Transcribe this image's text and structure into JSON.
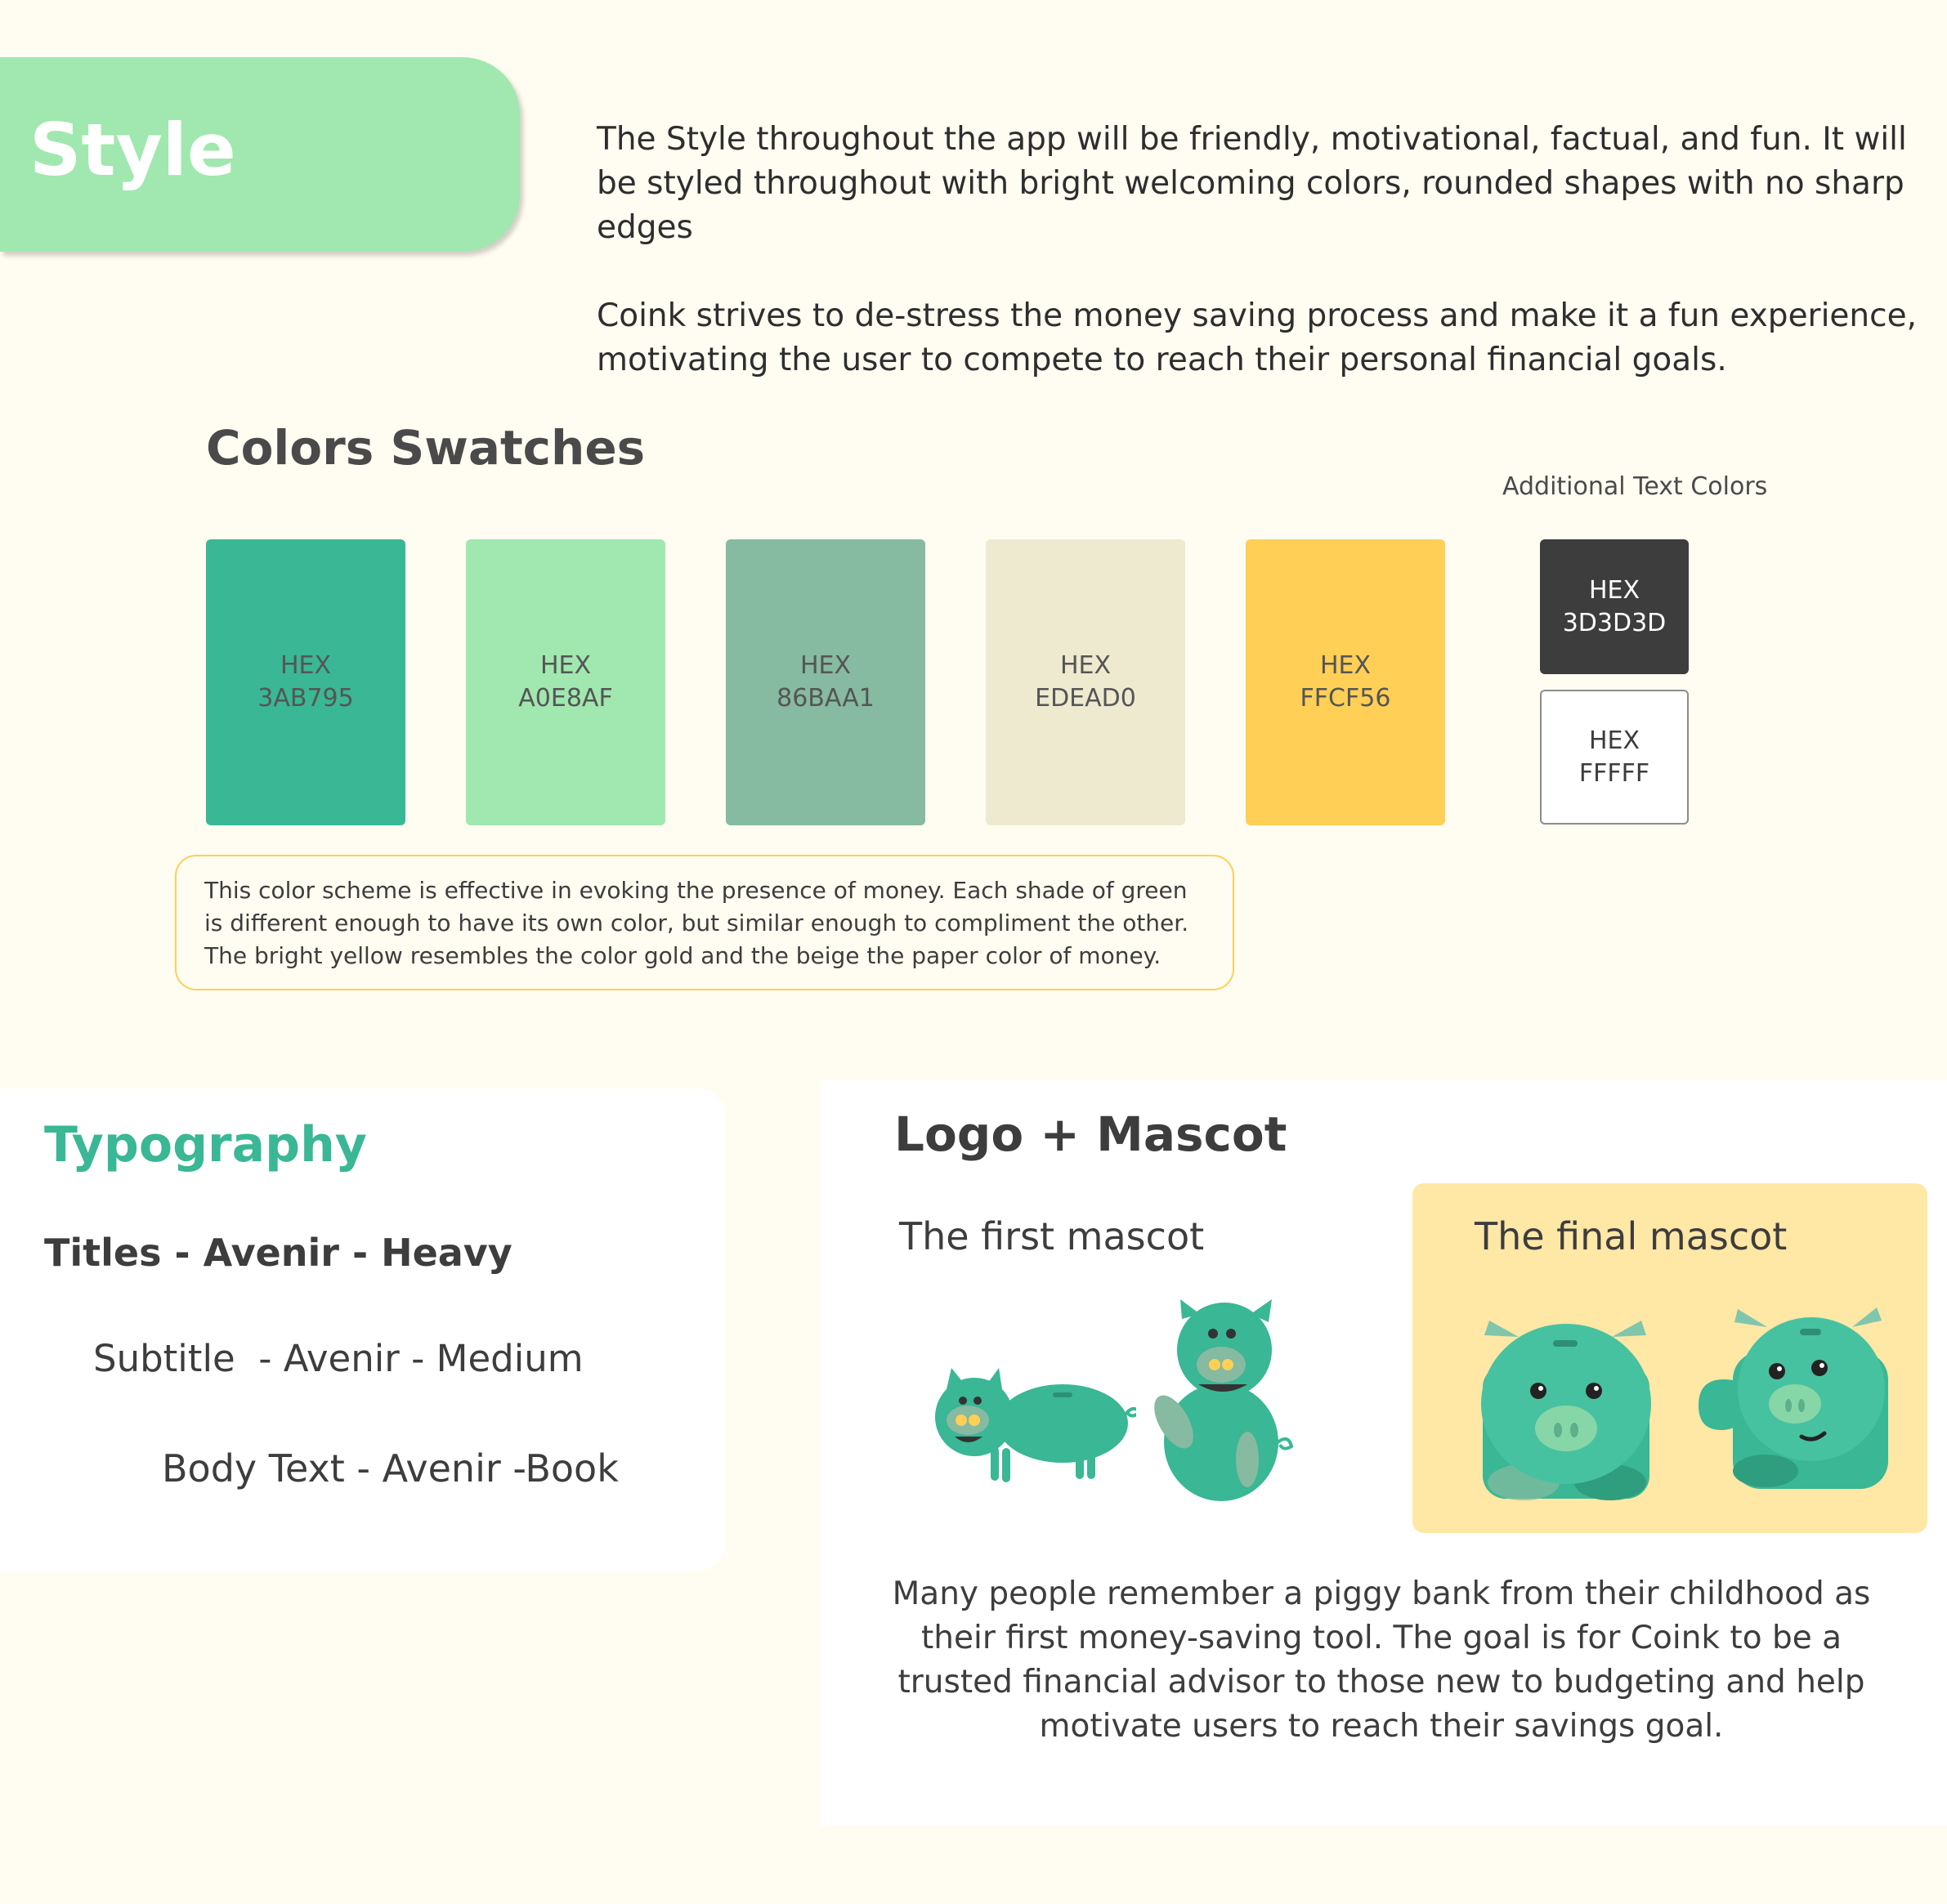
{
  "header": {
    "title": "Style",
    "intro_line1": "The Style throughout the app will be friendly, motivational, factual, and fun. It will be styled throughout with bright welcoming colors, rounded shapes with no sharp edges",
    "intro_line2": "Coink strives to de-stress the money saving process and make it a fun experience, motivating the user to compete to reach their personal financial goals."
  },
  "swatches": {
    "title": "Colors Swatches",
    "additional_label": "Additional Text Colors",
    "items": [
      {
        "label": "HEX",
        "code": "3AB795",
        "color": "#3AB795"
      },
      {
        "label": "HEX",
        "code": "A0E8AF",
        "color": "#A0E8AF"
      },
      {
        "label": "HEX",
        "code": "86BAA1",
        "color": "#86BAA1"
      },
      {
        "label": "HEX",
        "code": "EDEAD0",
        "color": "#EDEAD0"
      },
      {
        "label": "HEX",
        "code": "FFCF56",
        "color": "#FFCF56"
      }
    ],
    "text_colors": [
      {
        "label": "HEX",
        "code": "3D3D3D",
        "color": "#3D3D3D"
      },
      {
        "label": "HEX",
        "code": "FFFFF",
        "color": "#FFFFFF"
      }
    ],
    "note": "This color scheme is effective in evoking the presence of money. Each shade of green is different enough to have its own color, but similar enough to compliment the other. The bright yellow resembles the color gold and the beige the paper color of money."
  },
  "typography": {
    "title": "Typography",
    "titles_line": "Titles - Avenir - Heavy",
    "subtitle_line": "Subtitle  - Avenir - Medium",
    "body_line": "Body Text - Avenir -Book"
  },
  "logo": {
    "title": "Logo + Mascot",
    "first_label": "The first mascot",
    "final_label": "The final mascot",
    "description": "Many people remember a piggy bank from their childhood as their first money-saving tool. The goal is for Coink to be a trusted financial advisor to those new to budgeting and help motivate users to reach their savings goal."
  },
  "icons": [
    "first-mascot-pig-side",
    "first-mascot-pig-waving",
    "final-mascot-piggy-bank",
    "final-mascot-piggy-waving"
  ]
}
